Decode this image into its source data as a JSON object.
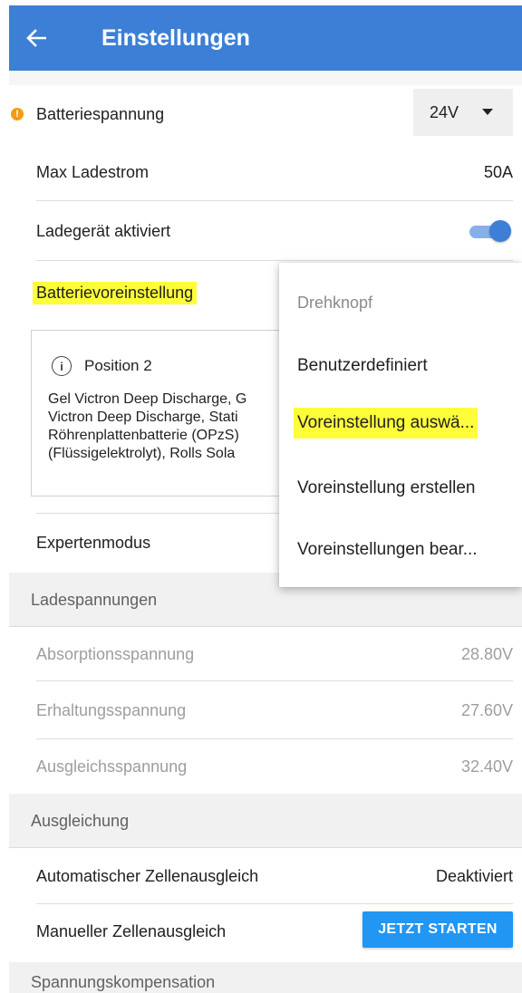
{
  "header": {
    "title": "Einstellungen",
    "back_icon": "arrow-left-icon"
  },
  "rows": {
    "battery_voltage": {
      "label": "Batteriespannung",
      "value": "24V",
      "warning_icon": "warning-icon"
    },
    "max_current": {
      "label": "Max Ladestrom",
      "value": "50A"
    },
    "charger_enabled": {
      "label": "Ladegerät aktiviert",
      "on": true
    },
    "battery_preset": {
      "label": "Batterievoreinstellung"
    },
    "expert_mode": {
      "label": "Expertenmodus"
    },
    "section_charge_voltages": {
      "label": "Ladespannungen"
    },
    "absorption": {
      "label": "Absorptionsspannung",
      "value": "28.80V"
    },
    "float": {
      "label": "Erhaltungsspannung",
      "value": "27.60V"
    },
    "equalization_voltage": {
      "label": "Ausgleichsspannung",
      "value": "32.40V"
    },
    "section_equalization": {
      "label": "Ausgleichung"
    },
    "auto_balance": {
      "label": "Automatischer Zellenausgleich",
      "value": "Deaktiviert"
    },
    "manual_balance": {
      "label": "Manueller Zellenausgleich",
      "button": "JETZT STARTEN"
    },
    "section_voltage_comp": {
      "label": "Spannungskompensation"
    }
  },
  "info_card": {
    "title": "Position 2",
    "lines": [
      "Gel Victron Deep Discharge, G",
      "Victron Deep Discharge, Stati",
      "Röhrenplattenbatterie (OPzS)",
      "(Flüssigelektrolyt), Rolls Sola"
    ]
  },
  "dropdown": {
    "header": "Drehknopf",
    "items": [
      "Benutzerdefiniert",
      "Voreinstellung auswä...",
      "Voreinstellung erstellen",
      "Voreinstellungen bear..."
    ]
  },
  "colors": {
    "appbar": "#3d7fd6",
    "highlight": "#fdfd3a",
    "button": "#2196f3"
  }
}
